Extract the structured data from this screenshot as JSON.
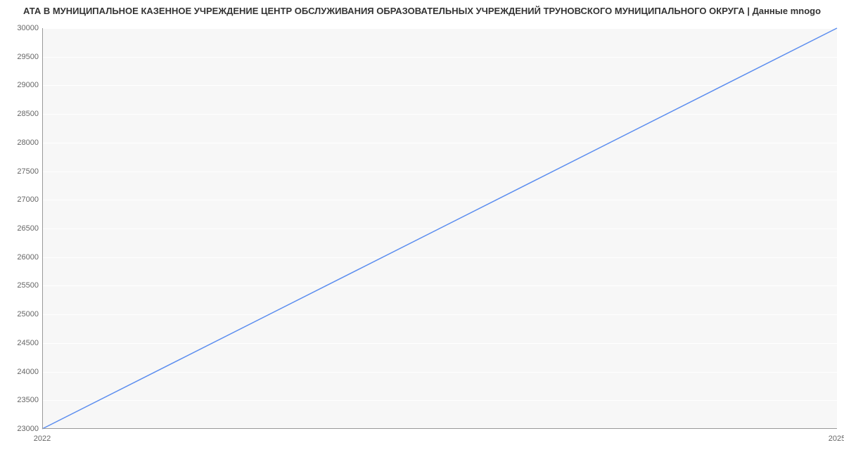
{
  "title": "АТА В МУНИЦИПАЛЬНОЕ КАЗЕННОЕ УЧРЕЖДЕНИЕ ЦЕНТР ОБСЛУЖИВАНИЯ ОБРАЗОВАТЕЛЬНЫХ УЧРЕЖДЕНИЙ ТРУНОВСКОГО МУНИЦИПАЛЬНОГО ОКРУГА | Данные mnogo",
  "chart_data": {
    "type": "line",
    "x": [
      2022,
      2025
    ],
    "values": [
      23000,
      30000
    ],
    "title": "АТА В МУНИЦИПАЛЬНОЕ КАЗЕННОЕ УЧРЕЖДЕНИЕ ЦЕНТР ОБСЛУЖИВАНИЯ ОБРАЗОВАТЕЛЬНЫХ УЧРЕЖДЕНИЙ ТРУНОВСКОГО МУНИЦИПАЛЬНОГО ОКРУГА | Данные mnogo",
    "xlabel": "",
    "ylabel": "",
    "xlim": [
      2022,
      2025
    ],
    "ylim": [
      23000,
      30000
    ],
    "y_ticks": [
      23000,
      23500,
      24000,
      24500,
      25000,
      25500,
      26000,
      26500,
      27000,
      27500,
      28000,
      28500,
      29000,
      29500,
      30000
    ],
    "x_ticks": [
      2022,
      2025
    ],
    "line_color": "#5b8def"
  }
}
